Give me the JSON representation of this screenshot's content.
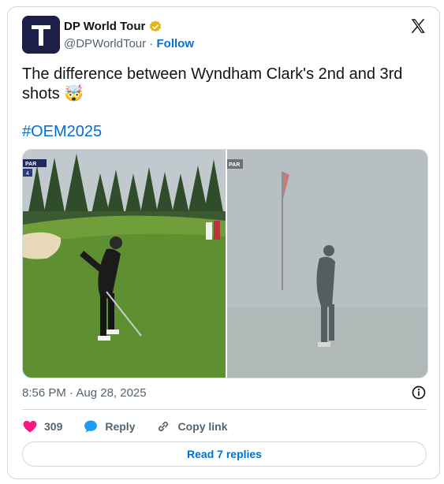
{
  "author": {
    "name": "DP World Tour",
    "handle": "@DPWorldTour",
    "separator": "·",
    "follow_label": "Follow",
    "verified": true,
    "icon": "verified-badge-icon"
  },
  "tweet": {
    "text_line1": "The difference between Wyndham Clark's 2nd and 3rd",
    "text_line2": "shots",
    "emoji": "🤯",
    "hashtag": "#OEM2025"
  },
  "media": {
    "left_badge": "PAR",
    "left_badge_num": "4",
    "right_badge": "PAR"
  },
  "meta": {
    "timestamp": "8:56 PM · Aug 28, 2025"
  },
  "actions": {
    "like_count": "309",
    "reply_label": "Reply",
    "copy_label": "Copy link"
  },
  "read_replies_label": "Read 7 replies",
  "colors": {
    "accent": "#006fd6",
    "like": "#f91880",
    "reply_icon": "#1d9bf0"
  }
}
